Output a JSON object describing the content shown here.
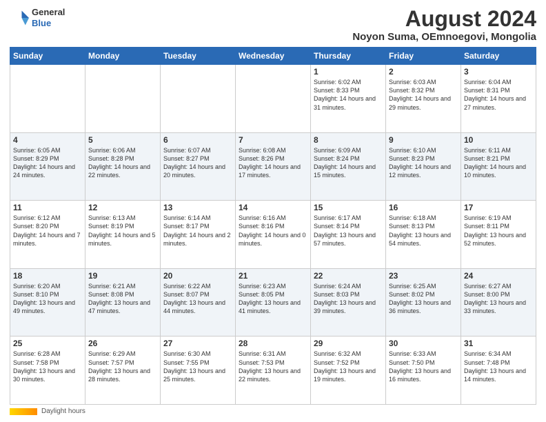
{
  "logo": {
    "text_general": "General",
    "text_blue": "Blue"
  },
  "title": {
    "month_year": "August 2024",
    "location": "Noyon Suma, OEmnoegovi, Mongolia"
  },
  "weekdays": [
    "Sunday",
    "Monday",
    "Tuesday",
    "Wednesday",
    "Thursday",
    "Friday",
    "Saturday"
  ],
  "footer": {
    "label": "Daylight hours"
  },
  "weeks": [
    [
      {
        "day": "",
        "info": ""
      },
      {
        "day": "",
        "info": ""
      },
      {
        "day": "",
        "info": ""
      },
      {
        "day": "",
        "info": ""
      },
      {
        "day": "1",
        "info": "Sunrise: 6:02 AM\nSunset: 8:33 PM\nDaylight: 14 hours\nand 31 minutes."
      },
      {
        "day": "2",
        "info": "Sunrise: 6:03 AM\nSunset: 8:32 PM\nDaylight: 14 hours\nand 29 minutes."
      },
      {
        "day": "3",
        "info": "Sunrise: 6:04 AM\nSunset: 8:31 PM\nDaylight: 14 hours\nand 27 minutes."
      }
    ],
    [
      {
        "day": "4",
        "info": "Sunrise: 6:05 AM\nSunset: 8:29 PM\nDaylight: 14 hours\nand 24 minutes."
      },
      {
        "day": "5",
        "info": "Sunrise: 6:06 AM\nSunset: 8:28 PM\nDaylight: 14 hours\nand 22 minutes."
      },
      {
        "day": "6",
        "info": "Sunrise: 6:07 AM\nSunset: 8:27 PM\nDaylight: 14 hours\nand 20 minutes."
      },
      {
        "day": "7",
        "info": "Sunrise: 6:08 AM\nSunset: 8:26 PM\nDaylight: 14 hours\nand 17 minutes."
      },
      {
        "day": "8",
        "info": "Sunrise: 6:09 AM\nSunset: 8:24 PM\nDaylight: 14 hours\nand 15 minutes."
      },
      {
        "day": "9",
        "info": "Sunrise: 6:10 AM\nSunset: 8:23 PM\nDaylight: 14 hours\nand 12 minutes."
      },
      {
        "day": "10",
        "info": "Sunrise: 6:11 AM\nSunset: 8:21 PM\nDaylight: 14 hours\nand 10 minutes."
      }
    ],
    [
      {
        "day": "11",
        "info": "Sunrise: 6:12 AM\nSunset: 8:20 PM\nDaylight: 14 hours\nand 7 minutes."
      },
      {
        "day": "12",
        "info": "Sunrise: 6:13 AM\nSunset: 8:19 PM\nDaylight: 14 hours\nand 5 minutes."
      },
      {
        "day": "13",
        "info": "Sunrise: 6:14 AM\nSunset: 8:17 PM\nDaylight: 14 hours\nand 2 minutes."
      },
      {
        "day": "14",
        "info": "Sunrise: 6:16 AM\nSunset: 8:16 PM\nDaylight: 14 hours\nand 0 minutes."
      },
      {
        "day": "15",
        "info": "Sunrise: 6:17 AM\nSunset: 8:14 PM\nDaylight: 13 hours\nand 57 minutes."
      },
      {
        "day": "16",
        "info": "Sunrise: 6:18 AM\nSunset: 8:13 PM\nDaylight: 13 hours\nand 54 minutes."
      },
      {
        "day": "17",
        "info": "Sunrise: 6:19 AM\nSunset: 8:11 PM\nDaylight: 13 hours\nand 52 minutes."
      }
    ],
    [
      {
        "day": "18",
        "info": "Sunrise: 6:20 AM\nSunset: 8:10 PM\nDaylight: 13 hours\nand 49 minutes."
      },
      {
        "day": "19",
        "info": "Sunrise: 6:21 AM\nSunset: 8:08 PM\nDaylight: 13 hours\nand 47 minutes."
      },
      {
        "day": "20",
        "info": "Sunrise: 6:22 AM\nSunset: 8:07 PM\nDaylight: 13 hours\nand 44 minutes."
      },
      {
        "day": "21",
        "info": "Sunrise: 6:23 AM\nSunset: 8:05 PM\nDaylight: 13 hours\nand 41 minutes."
      },
      {
        "day": "22",
        "info": "Sunrise: 6:24 AM\nSunset: 8:03 PM\nDaylight: 13 hours\nand 39 minutes."
      },
      {
        "day": "23",
        "info": "Sunrise: 6:25 AM\nSunset: 8:02 PM\nDaylight: 13 hours\nand 36 minutes."
      },
      {
        "day": "24",
        "info": "Sunrise: 6:27 AM\nSunset: 8:00 PM\nDaylight: 13 hours\nand 33 minutes."
      }
    ],
    [
      {
        "day": "25",
        "info": "Sunrise: 6:28 AM\nSunset: 7:58 PM\nDaylight: 13 hours\nand 30 minutes."
      },
      {
        "day": "26",
        "info": "Sunrise: 6:29 AM\nSunset: 7:57 PM\nDaylight: 13 hours\nand 28 minutes."
      },
      {
        "day": "27",
        "info": "Sunrise: 6:30 AM\nSunset: 7:55 PM\nDaylight: 13 hours\nand 25 minutes."
      },
      {
        "day": "28",
        "info": "Sunrise: 6:31 AM\nSunset: 7:53 PM\nDaylight: 13 hours\nand 22 minutes."
      },
      {
        "day": "29",
        "info": "Sunrise: 6:32 AM\nSunset: 7:52 PM\nDaylight: 13 hours\nand 19 minutes."
      },
      {
        "day": "30",
        "info": "Sunrise: 6:33 AM\nSunset: 7:50 PM\nDaylight: 13 hours\nand 16 minutes."
      },
      {
        "day": "31",
        "info": "Sunrise: 6:34 AM\nSunset: 7:48 PM\nDaylight: 13 hours\nand 14 minutes."
      }
    ]
  ]
}
